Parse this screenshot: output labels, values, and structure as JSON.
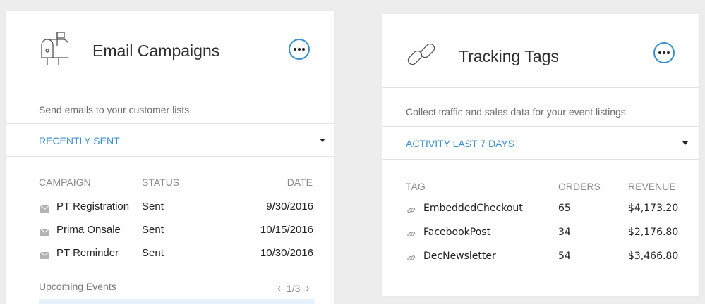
{
  "email_card": {
    "title": "Email Campaigns",
    "icon": "mailbox-icon",
    "description": "Send emails to your customer lists.",
    "filter_label": "RECENTLY SENT",
    "columns": {
      "campaign": "CAMPAIGN",
      "status": "STATUS",
      "date": "DATE"
    },
    "rows": [
      {
        "campaign": "PT Registration",
        "status": "Sent",
        "date": "9/30/2016"
      },
      {
        "campaign": "Prima Onsale",
        "status": "Sent",
        "date": "10/15/2016"
      },
      {
        "campaign": "PT Reminder",
        "status": "Sent",
        "date": "10/30/2016"
      }
    ],
    "upcoming_label": "Upcoming Events",
    "pager": {
      "prev": "‹",
      "page": "1/3",
      "next": "›"
    }
  },
  "tags_card": {
    "title": "Tracking Tags",
    "icon": "chain-link-icon",
    "description": "Collect traffic and sales data for your event listings.",
    "filter_label": "ACTIVITY LAST 7 DAYS",
    "columns": {
      "tag": "TAG",
      "orders": "ORDERS",
      "revenue": "REVENUE"
    },
    "rows": [
      {
        "tag": "EmbeddedCheckout",
        "orders": "65",
        "revenue": "$4,173.20"
      },
      {
        "tag": "FacebookPost",
        "orders": "34",
        "revenue": "$2,176.80"
      },
      {
        "tag": "DecNewsletter",
        "orders": "54",
        "revenue": "$3,466.80"
      }
    ]
  },
  "colors": {
    "accent": "#3a8fd0",
    "background": "#ededed",
    "card": "#ffffff"
  }
}
